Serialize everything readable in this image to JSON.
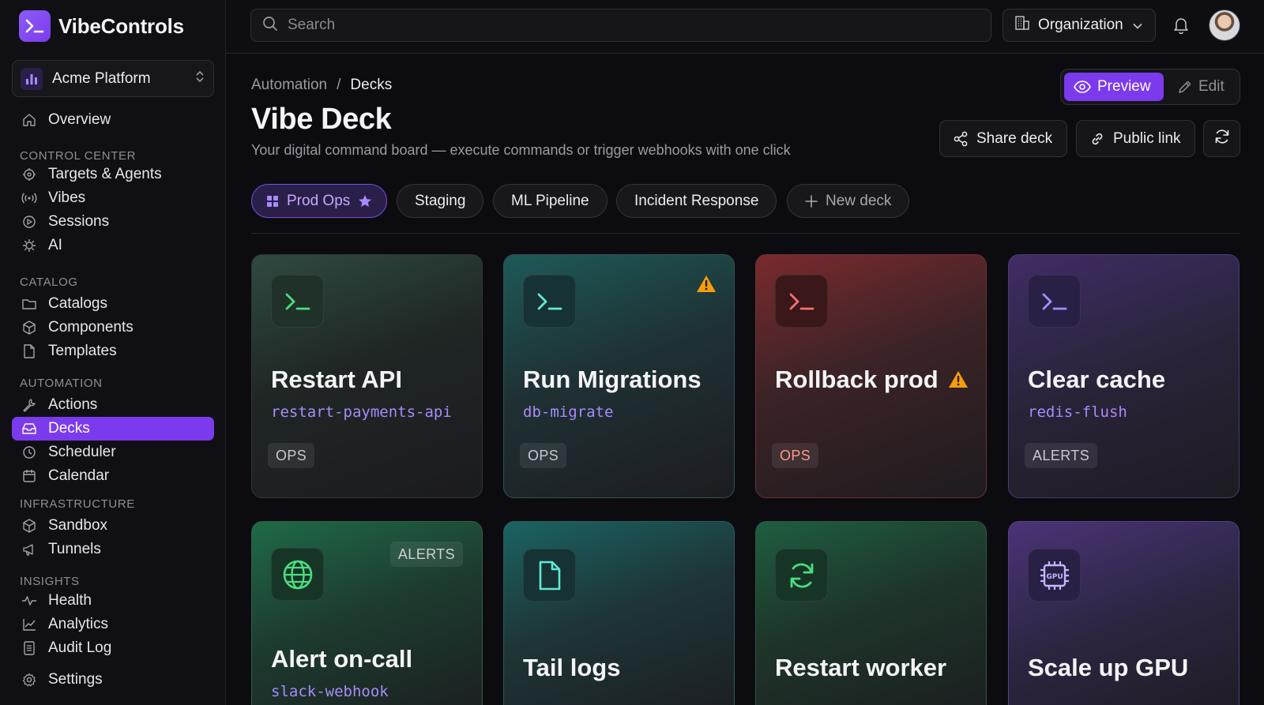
{
  "app": {
    "name": "VibeControls"
  },
  "project": {
    "name": "Acme Platform"
  },
  "sidebar": {
    "overview": "Overview",
    "sections": {
      "control_center": "CONTROL CENTER",
      "catalog": "CATALOG",
      "automation": "AUTOMATION",
      "infrastructure": "INFRASTRUCTURE",
      "insights": "INSIGHTS"
    },
    "items": {
      "targets": "Targets & Agents",
      "vibes": "Vibes",
      "sessions": "Sessions",
      "ai": "AI",
      "catalogs": "Catalogs",
      "components": "Components",
      "templates": "Templates",
      "actions": "Actions",
      "decks": "Decks",
      "scheduler": "Scheduler",
      "calendar": "Calendar",
      "sandbox": "Sandbox",
      "tunnels": "Tunnels",
      "health": "Health",
      "analytics": "Analytics",
      "audit_log": "Audit Log",
      "settings": "Settings"
    },
    "active_item": "Decks"
  },
  "topbar": {
    "search_placeholder": "Search",
    "org_label": "Organization"
  },
  "header": {
    "breadcrumb": [
      "Automation",
      "/",
      "Decks"
    ],
    "title": "Vibe Deck",
    "subtitle": "Your digital command board — execute commands or trigger webhooks with one click",
    "mode": {
      "preview": "Preview",
      "edit": "Edit",
      "active": "Preview"
    },
    "share_label": "Share deck",
    "public_link_label": "Public link"
  },
  "tabs": {
    "items": [
      "Prod Ops",
      "Staging",
      "ML Pipeline",
      "Incident Response"
    ],
    "active": "Prod Ops",
    "new_label": "New deck"
  },
  "cards": [
    {
      "title": "Restart API",
      "command": "restart-payments-api",
      "tag": "OPS",
      "icon": "terminal-icon",
      "warning": false
    },
    {
      "title": "Run Migrations",
      "command": "db-migrate",
      "tag": "OPS",
      "icon": "terminal-icon",
      "warning": true
    },
    {
      "title": "Rollback prod",
      "command": "",
      "tag": "OPS",
      "icon": "terminal-icon",
      "warning": true
    },
    {
      "title": "Clear cache",
      "command": "redis-flush",
      "tag": "ALERTS",
      "icon": "terminal-icon",
      "warning": false
    },
    {
      "title": "Alert on-call",
      "command": "slack-webhook",
      "tag": "ALERTS",
      "icon": "globe-icon",
      "warning": false
    },
    {
      "title": "Tail logs",
      "command": "",
      "tag": "",
      "icon": "file-icon",
      "warning": false
    },
    {
      "title": "Restart worker",
      "command": "",
      "tag": "",
      "icon": "refresh-icon",
      "warning": false
    },
    {
      "title": "Scale up GPU",
      "command": "",
      "tag": "",
      "icon": "gpu-chip-icon",
      "gpu_label": "GPU",
      "warning": false
    }
  ],
  "colors": {
    "accent": "#7c3aed",
    "accent_text": "#a78bfa",
    "warning": "#f59e0b",
    "background": "#0c0c10"
  }
}
